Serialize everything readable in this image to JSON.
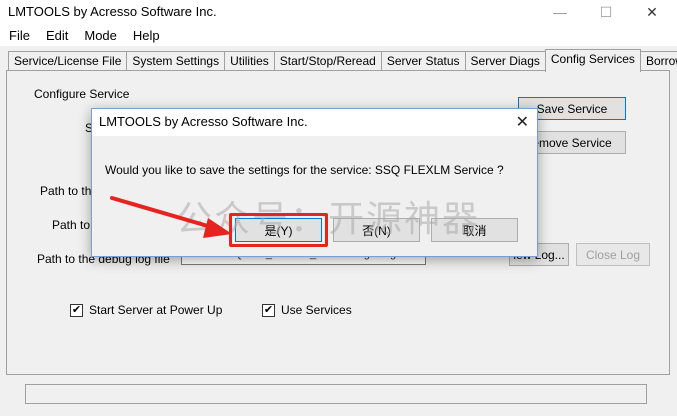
{
  "window": {
    "title": "LMTOOLS by Acresso Software Inc.",
    "min_glyph": "—",
    "max_glyph": "☐",
    "close_glyph": "✕"
  },
  "menu": [
    "File",
    "Edit",
    "Mode",
    "Help"
  ],
  "tabs": [
    "Service/License File",
    "System Settings",
    "Utilities",
    "Start/Stop/Reread",
    "Server Status",
    "Server Diags",
    "Config Services",
    "Borrowing"
  ],
  "config": {
    "configure_service_label": "Configure Service",
    "service_name_label_partial": "S",
    "path_lmgrd_partial": "Path to the",
    "path_license_partial": "Path to t",
    "path_debug_log_label": "Path to the debug log file",
    "debug_log_path_partial": "C:\\Tools\\SQUAD_License_Server\\Logs\\lmgrd.lc",
    "save_service": "Save Service",
    "remove_service": "emove Service",
    "view_log": "iew Log...",
    "close_log": "Close Log",
    "start_server_at_power_up": "Start Server at Power Up",
    "use_services": "Use Services",
    "check_glyph": "✔"
  },
  "dialog": {
    "title": "LMTOOLS by Acresso Software Inc.",
    "close_glyph": "✕",
    "message": "Would you like to save the settings for the service:   SSQ FLEXLM Service   ?",
    "yes_label": "是(Y)",
    "no_label": "否(N)",
    "cancel_label": "取消"
  },
  "watermark": "公众号：开源神器",
  "colors": {
    "accent": "#0078d7",
    "highlight": "#e52420"
  }
}
